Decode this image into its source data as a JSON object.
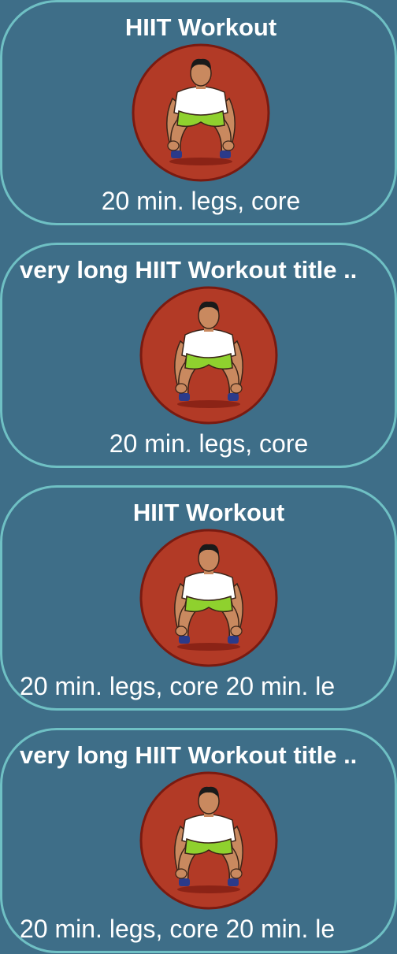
{
  "cards": [
    {
      "title": "HIIT Workout",
      "subtitle": "20 min. legs, core"
    },
    {
      "title": "very long HIIT Workout title ..",
      "subtitle": "20 min. legs, core"
    },
    {
      "title": "HIIT Workout",
      "subtitle": "20 min. legs, core 20 min. le"
    },
    {
      "title": "very long HIIT Workout title ..",
      "subtitle": "20 min. legs, core 20 min. le"
    }
  ],
  "colors": {
    "background": "#3e6e88",
    "card_border": "#6fc0c4",
    "thumb_circle": "#b23a26",
    "thumb_ring": "#7a1a10"
  },
  "icons": {
    "thumbnail": "crouching-athlete-icon"
  }
}
